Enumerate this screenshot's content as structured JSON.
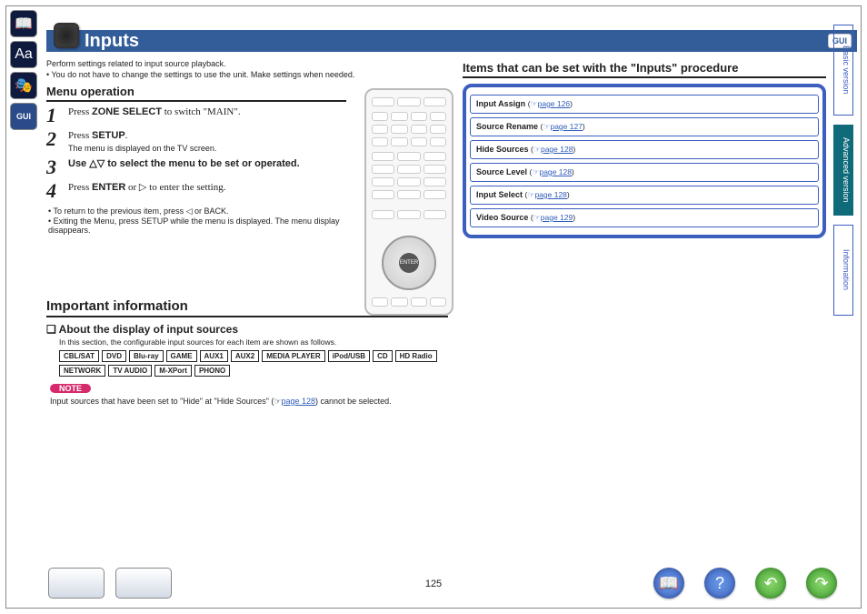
{
  "header": {
    "title": "Inputs",
    "gui_label": "GUI"
  },
  "left_icons": [
    "book-icon",
    "font-icon",
    "mask-icon",
    "gui-icon"
  ],
  "intro": "Perform settings related to input source playback.",
  "intro_bullet": "You do not have to change the settings to use the unit. Make settings when needed.",
  "menu_operation": {
    "heading": "Menu operation",
    "steps": [
      {
        "n": "1",
        "main_a": "Press ",
        "bold": "ZONE SELECT",
        "main_b": " to switch \"MAIN\"."
      },
      {
        "n": "2",
        "main_a": "Press ",
        "bold": "SETUP",
        "main_b": ".",
        "sub": "The menu is displayed on the TV screen."
      },
      {
        "n": "3",
        "main_a": "Use △▽ to select the menu to be set or operated.",
        "bold": "",
        "main_b": ""
      },
      {
        "n": "4",
        "main_a": "Press ",
        "bold": "ENTER",
        "main_b": " or ▷ to enter the setting."
      }
    ],
    "notes": [
      "To return to the previous item, press ◁ or BACK.",
      "Exiting the Menu, press SETUP while the menu is displayed. The menu display disappears."
    ]
  },
  "important": {
    "heading": "Important information",
    "subheading": "About the display of input sources",
    "note": "In this section, the configurable input sources for each item are shown as follows.",
    "sources": [
      "CBL/SAT",
      "DVD",
      "Blu-ray",
      "GAME",
      "AUX1",
      "AUX2",
      "MEDIA PLAYER",
      "iPod/USB",
      "CD",
      "HD Radio",
      "NETWORK",
      "TV AUDIO",
      "M-XPort",
      "PHONO"
    ],
    "note_label": "NOTE",
    "foot_note_a": "Input sources that have been set to \"Hide\" at \"Hide Sources\" (",
    "foot_note_link": "page 128",
    "foot_note_b": ") cannot be selected."
  },
  "items_panel": {
    "heading": "Items that can be set with the \"Inputs\" procedure",
    "items": [
      {
        "label": "Input Assign",
        "page": "page 126"
      },
      {
        "label": "Source Rename",
        "page": "page 127"
      },
      {
        "label": "Hide Sources",
        "page": "page 128"
      },
      {
        "label": "Source Level",
        "page": "page 128"
      },
      {
        "label": "Input Select",
        "page": "page 128"
      },
      {
        "label": "Video Source",
        "page": "page 129"
      }
    ]
  },
  "vtabs": [
    {
      "label": "Basic version",
      "active": false
    },
    {
      "label": "Advanced version",
      "active": true
    },
    {
      "label": "Information",
      "active": false
    }
  ],
  "footer": {
    "page_number": "125"
  }
}
